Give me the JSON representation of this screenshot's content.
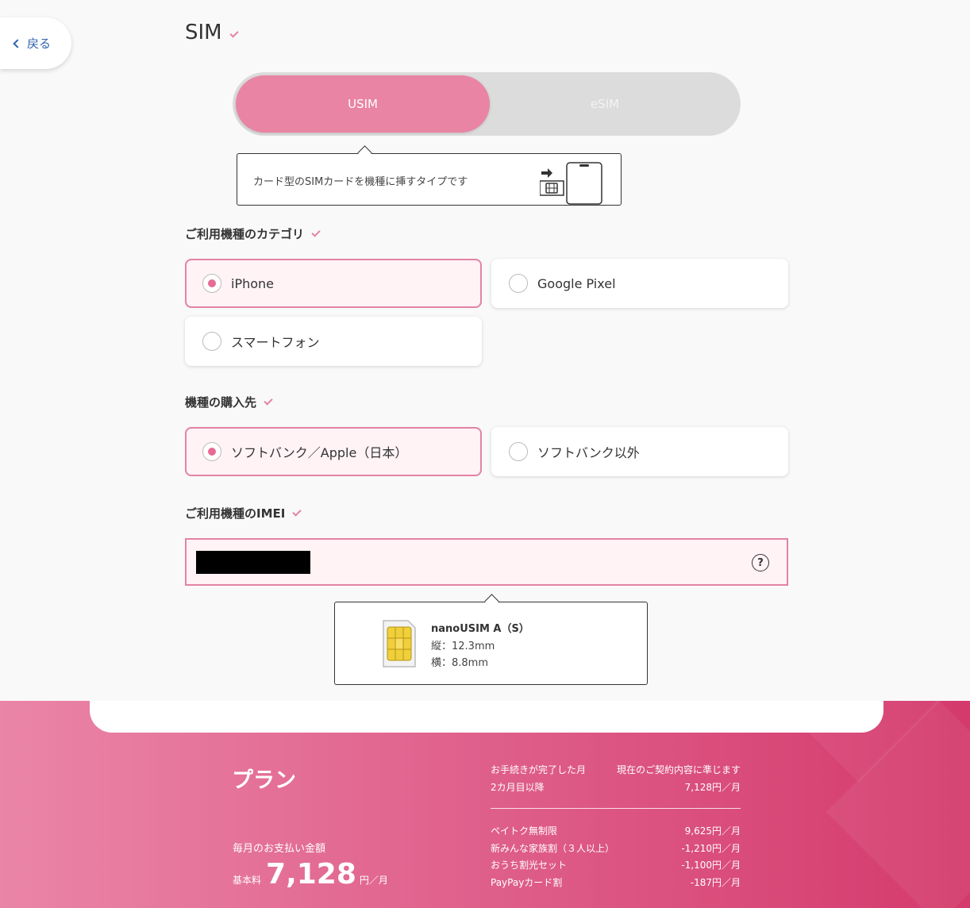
{
  "nav": {
    "back_label": "戻る"
  },
  "sim": {
    "title": "SIM",
    "toggle": {
      "usim": "USIM",
      "esim": "eSIM"
    },
    "usim_tip": "カード型のSIMカードを機種に挿すタイプです"
  },
  "category": {
    "label": "ご利用機種のカテゴリ",
    "options": [
      "iPhone",
      "Google Pixel",
      "スマートフォン"
    ],
    "selected": "iPhone"
  },
  "purchase": {
    "label": "機種の購入先",
    "options": [
      "ソフトバンク／Apple（日本）",
      "ソフトバンク以外"
    ],
    "selected": "ソフトバンク／Apple（日本）"
  },
  "imei": {
    "label": "ご利用機種のIMEI",
    "help": "?"
  },
  "sim_card": {
    "name": "nanoUSIM A（S）",
    "height": "縦：12.3mm",
    "width": "横：8.8mm"
  },
  "footer": {
    "plan_title": "プラン",
    "monthly_label": "毎月のお支払い金額",
    "base_label": "基本料",
    "base_amount": "7,128",
    "base_unit": "円／月",
    "rows_top": [
      {
        "label": "お手続きが完了した月",
        "value": "現在のご契約内容に準じます"
      },
      {
        "label": "2カ月目以降",
        "value": "7,128円／月"
      }
    ],
    "rows_bottom": [
      {
        "label": "ペイトク無制限",
        "value": "9,625円／月"
      },
      {
        "label": "新みんな家族割（３人以上）",
        "value": "-1,210円／月"
      },
      {
        "label": "おうち割光セット",
        "value": "-1,100円／月"
      },
      {
        "label": "PayPayカード割",
        "value": "-187円／月"
      }
    ]
  },
  "colors": {
    "accent": "#e984a4",
    "accent_border": "#e383a3",
    "selected_bg": "#fff3f6",
    "link": "#2f62b0"
  }
}
